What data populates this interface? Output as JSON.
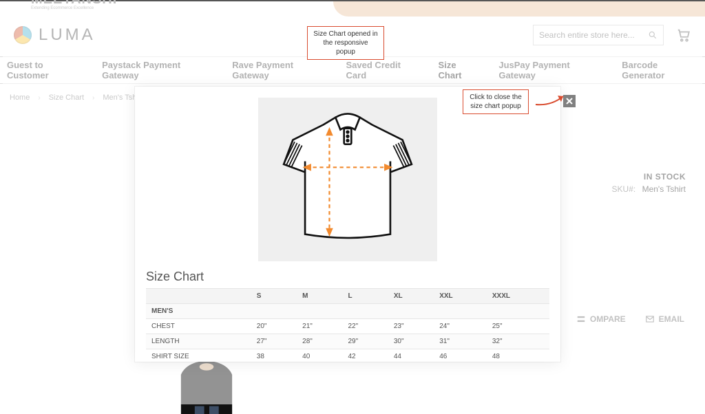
{
  "brand_top": "MEETANSHI",
  "brand_top_tag": "Extending Ecommerce Excellence",
  "logo_text": "LUMA",
  "search": {
    "placeholder": "Search entire store here..."
  },
  "nav": {
    "items": [
      "Guest to Customer",
      "Paystack Payment Gateway",
      "Rave Payment Gateway",
      "Saved Credit Card",
      "Size Chart",
      "JusPay Payment Gateway",
      "Barcode Generator"
    ],
    "active_index": 4
  },
  "breadcrumb": [
    "Home",
    "Size Chart",
    "Men's Tshirt"
  ],
  "stock": {
    "status": "IN STOCK",
    "sku_label": "SKU#:",
    "sku_value": "Men's Tshirt"
  },
  "actions": {
    "compare": "OMPARE",
    "email": "EMAIL"
  },
  "modal": {
    "title": "Size Chart",
    "section": "MEN'S",
    "headers": [
      "",
      "S",
      "M",
      "L",
      "XL",
      "XXL",
      "XXXL"
    ],
    "rows": [
      {
        "label": "CHEST",
        "vals": [
          "20\"",
          "21\"",
          "22\"",
          "23\"",
          "24\"",
          "25\""
        ]
      },
      {
        "label": "LENGTH",
        "vals": [
          "27\"",
          "28\"",
          "29\"",
          "30\"",
          "31\"",
          "32\""
        ]
      },
      {
        "label": "SHIRT SIZE",
        "vals": [
          "38",
          "40",
          "42",
          "44",
          "46",
          "48"
        ]
      }
    ]
  },
  "annotations": {
    "opened": "Size Chart opened in the responsive popup",
    "close_hint": "Click to close the size chart popup"
  }
}
